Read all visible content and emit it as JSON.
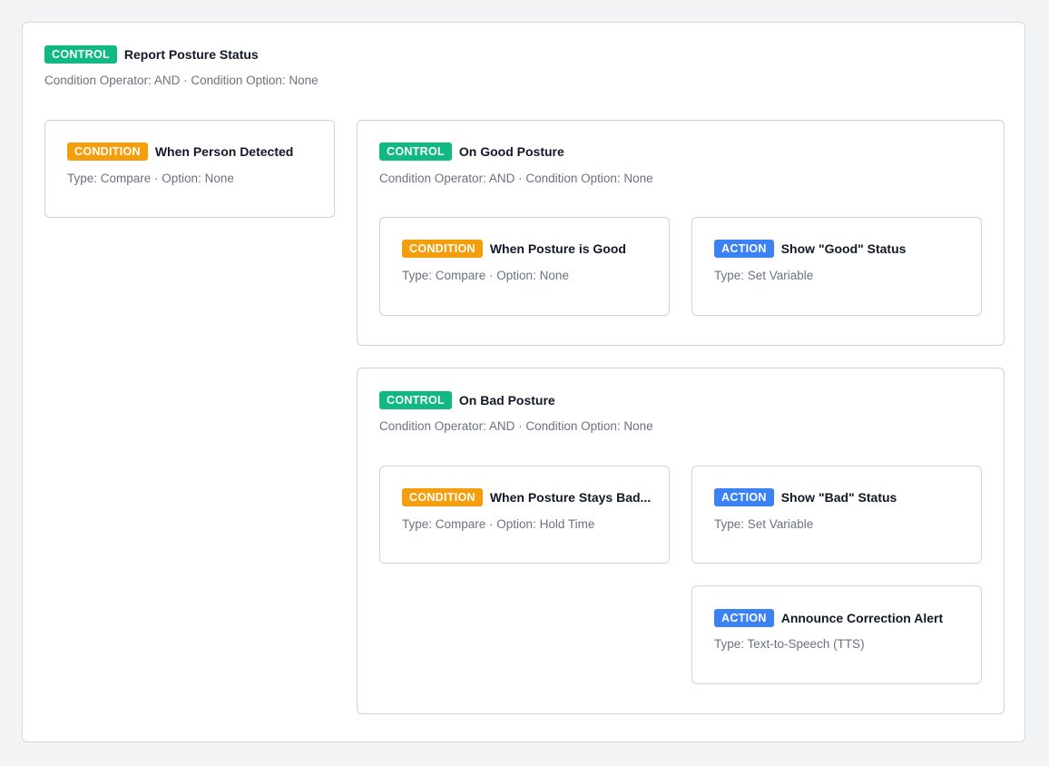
{
  "root": {
    "badge": "CONTROL",
    "title": "Report Posture Status",
    "meta": "Condition Operator: AND · Condition Option: None"
  },
  "person_detected": {
    "badge": "CONDITION",
    "title": "When Person Detected",
    "meta": "Type: Compare · Option: None"
  },
  "good_posture": {
    "badge": "CONTROL",
    "title": "On Good Posture",
    "meta": "Condition Operator: AND · Condition Option: None",
    "condition": {
      "badge": "CONDITION",
      "title": "When Posture is Good",
      "meta": "Type: Compare · Option: None"
    },
    "action": {
      "badge": "ACTION",
      "title": "Show \"Good\" Status",
      "meta": "Type: Set Variable"
    }
  },
  "bad_posture": {
    "badge": "CONTROL",
    "title": "On Bad Posture",
    "meta": "Condition Operator: AND · Condition Option: None",
    "condition": {
      "badge": "CONDITION",
      "title": "When Posture Stays Bad...",
      "meta": "Type: Compare · Option: Hold Time"
    },
    "action_status": {
      "badge": "ACTION",
      "title": "Show \"Bad\" Status",
      "meta": "Type: Set Variable"
    },
    "action_alert": {
      "badge": "ACTION",
      "title": "Announce Correction Alert",
      "meta": "Type: Text-to-Speech (TTS)"
    }
  }
}
